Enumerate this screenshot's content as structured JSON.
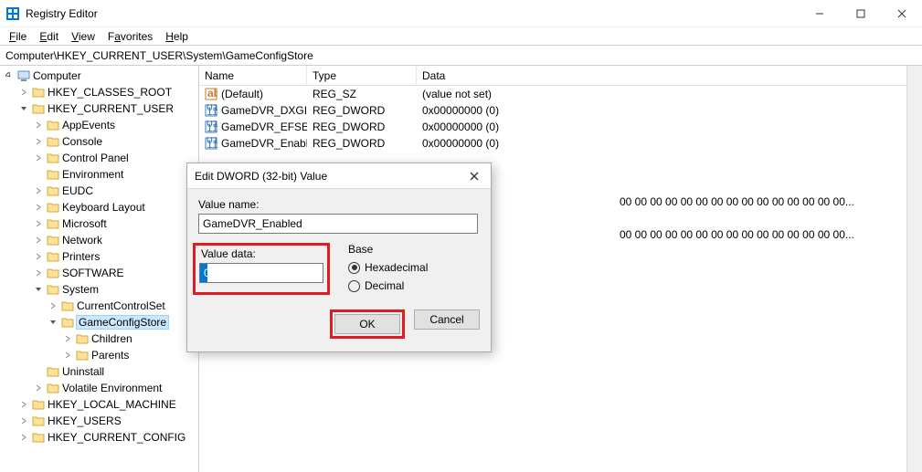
{
  "titlebar": {
    "title": "Registry Editor"
  },
  "menubar": {
    "file": "File",
    "edit": "Edit",
    "view": "View",
    "favorites": "Favorites",
    "help": "Help"
  },
  "addressbar": {
    "path": "Computer\\HKEY_CURRENT_USER\\System\\GameConfigStore"
  },
  "tree": {
    "root": "Computer",
    "hkcr": "HKEY_CLASSES_ROOT",
    "hkcu": "HKEY_CURRENT_USER",
    "hkcu_children": {
      "appevents": "AppEvents",
      "console": "Console",
      "controlpanel": "Control Panel",
      "environment": "Environment",
      "eudc": "EUDC",
      "keyboard": "Keyboard Layout",
      "microsoft": "Microsoft",
      "network": "Network",
      "printers": "Printers",
      "software": "SOFTWARE",
      "system": "System",
      "system_children": {
        "currentcontrolset": "CurrentControlSet",
        "gameconfigstore": "GameConfigStore",
        "gcs_children": {
          "children": "Children",
          "parents": "Parents"
        }
      },
      "uninstall": "Uninstall",
      "volatile": "Volatile Environment"
    },
    "hklm": "HKEY_LOCAL_MACHINE",
    "hku": "HKEY_USERS",
    "hkcc": "HKEY_CURRENT_CONFIG"
  },
  "list": {
    "headers": {
      "name": "Name",
      "type": "Type",
      "data": "Data"
    },
    "rows": [
      {
        "icon": "sz",
        "name": "(Default)",
        "type": "REG_SZ",
        "data": "(value not set)"
      },
      {
        "icon": "bin",
        "name": "GameDVR_DXGI...",
        "type": "REG_DWORD",
        "data": "0x00000000 (0)"
      },
      {
        "icon": "bin",
        "name": "GameDVR_EFSE...",
        "type": "REG_DWORD",
        "data": "0x00000000 (0)"
      },
      {
        "icon": "bin",
        "name": "GameDVR_Enabl...",
        "type": "REG_DWORD",
        "data": "0x00000000 (0)"
      }
    ],
    "extra": [
      "00 00 00 00 00 00 00 00 00 00 00 00 00 00 00...",
      "00 00 00 00 00 00 00 00 00 00 00 00 00 00 00..."
    ]
  },
  "dialog": {
    "title": "Edit DWORD (32-bit) Value",
    "valuename_label": "Value name:",
    "valuename": "GameDVR_Enabled",
    "valuedata_label": "Value data:",
    "valuedata": "0",
    "base_label": "Base",
    "hex": "Hexadecimal",
    "dec": "Decimal",
    "ok": "OK",
    "cancel": "Cancel"
  }
}
